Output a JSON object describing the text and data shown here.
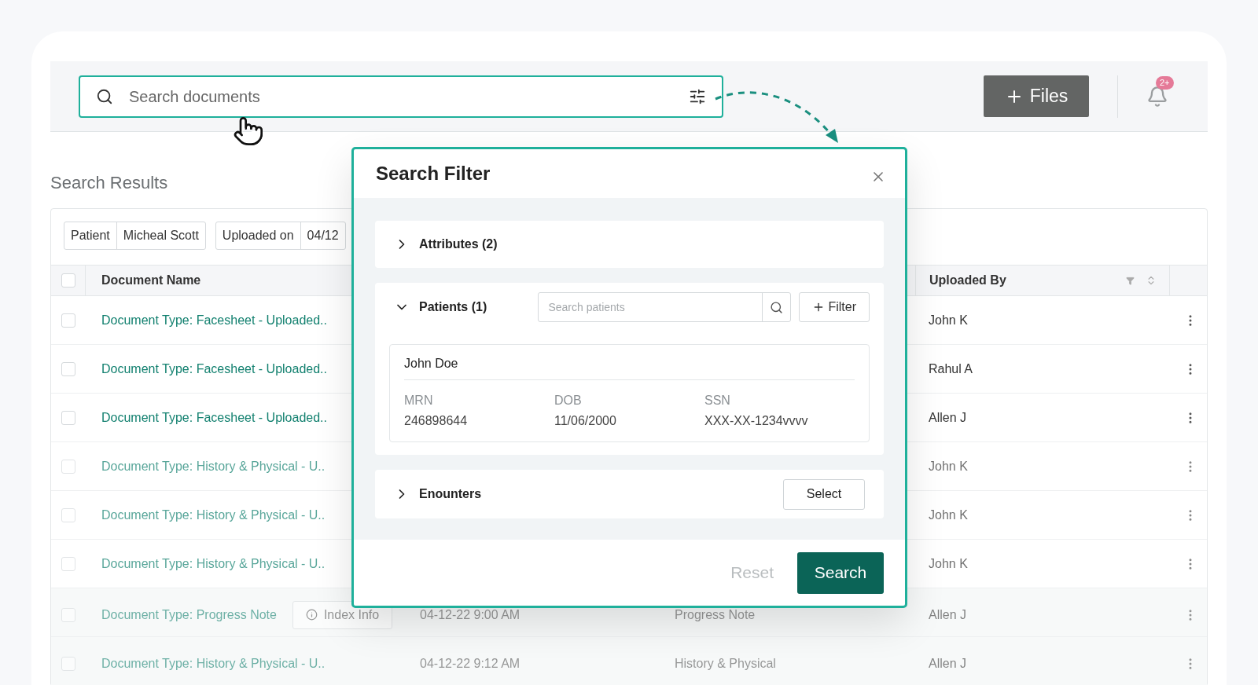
{
  "search": {
    "placeholder": "Search documents"
  },
  "header": {
    "add_button": "Files",
    "notification_badge": "2+"
  },
  "results": {
    "title": "Search Results",
    "filters": [
      {
        "label": "Patient",
        "value": "Micheal Scott"
      },
      {
        "label": "Uploaded on",
        "value": "04/12"
      }
    ],
    "columns": {
      "name": "Document Name",
      "uploaded_by": "Uploaded By"
    },
    "all_checked": false,
    "rows": [
      {
        "name": "Document Type: Facesheet - Uploaded..",
        "uploaded_by": "John K",
        "checked": false
      },
      {
        "name": "Document Type: Facesheet - Uploaded..",
        "uploaded_by": "Rahul A",
        "checked": false
      },
      {
        "name": "Document Type: Facesheet - Uploaded..",
        "uploaded_by": "Allen J",
        "checked": false
      },
      {
        "name": "Document Type: History & Physical - U..",
        "uploaded_by": "John K",
        "checked": false
      },
      {
        "name": "Document Type: History & Physical - U..",
        "uploaded_by": "John K",
        "checked": false
      },
      {
        "name": "Document Type: History & Physical - U..",
        "uploaded_by": "John K",
        "checked": false
      },
      {
        "name": "Document Type: Progress Note",
        "tag": "Index Info",
        "date": "04-12-22 9:00 AM",
        "type": "Progress Note",
        "uploaded_by": "Allen J",
        "checked": false
      },
      {
        "name": "Document Type: History & Physical - U..",
        "date": "04-12-22 9:12 AM",
        "type": "History & Physical",
        "uploaded_by": "Allen J",
        "checked": false
      }
    ]
  },
  "filter_dialog": {
    "title": "Search Filter",
    "sections": [
      {
        "kind": "collapsible",
        "label": "Attributes (2)",
        "expanded": false
      },
      {
        "kind": "patients",
        "label": "Patients (1)",
        "expanded": true,
        "search_placeholder": "Search patients",
        "filter_button": "Filter",
        "patient": {
          "name": "John Doe",
          "fields": [
            {
              "label": "MRN",
              "value": "246898644"
            },
            {
              "label": "DOB",
              "value": "11/06/2000"
            },
            {
              "label": "SSN",
              "value": "XXX-XX-1234vvvv"
            }
          ]
        }
      },
      {
        "kind": "select",
        "label": "Enounters",
        "expanded": false,
        "action": "Select"
      }
    ],
    "reset": "Reset",
    "submit": "Search"
  }
}
